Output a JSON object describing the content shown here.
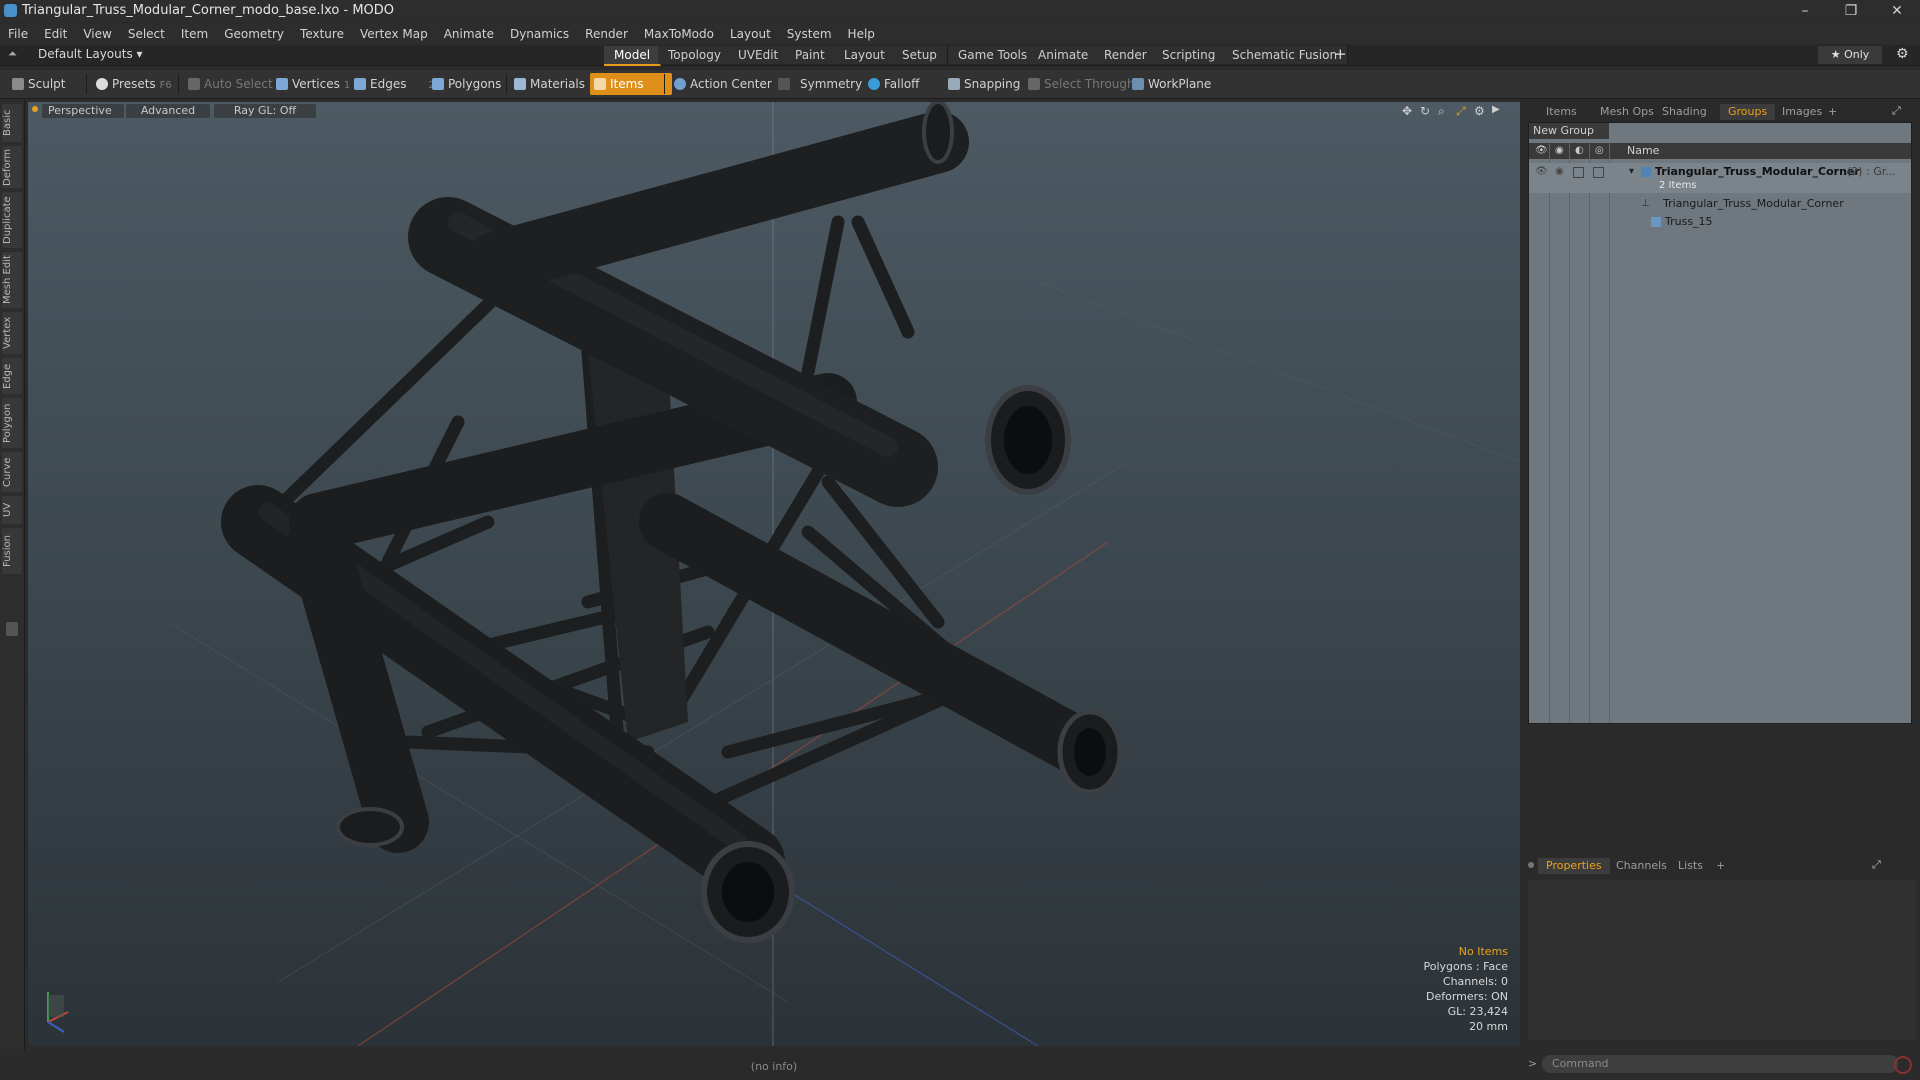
{
  "window": {
    "title": "Triangular_Truss_Modular_Corner_modo_base.lxo - MODO",
    "controls": [
      "–",
      "❐",
      "✕"
    ]
  },
  "menu": [
    "File",
    "Edit",
    "View",
    "Select",
    "Item",
    "Geometry",
    "Texture",
    "Vertex Map",
    "Animate",
    "Dynamics",
    "Render",
    "MaxToModo",
    "Layout",
    "System",
    "Help"
  ],
  "layoutbar": {
    "layouts_label": "Default Layouts ▾",
    "tabs": [
      "Model",
      "Topology",
      "UVEdit",
      "Paint",
      "Layout",
      "Setup",
      "Game Tools",
      "Animate",
      "Render",
      "Scripting",
      "Schematic Fusion"
    ],
    "active_tab": "Model",
    "add": "+",
    "only_label": "★  Only",
    "gear": "⚙"
  },
  "toolbar": {
    "sculpt": "Sculpt",
    "presets": "Presets",
    "presets_key": "F6",
    "auto_select": "Auto Select",
    "vertices": "Vertices",
    "vertices_key": "1",
    "edges": "Edges",
    "edges_key": "2",
    "polygons": "Polygons",
    "materials": "Materials",
    "items": "Items",
    "action_center": "Action Center",
    "symmetry": "Symmetry",
    "falloff": "Falloff",
    "snapping": "Snapping",
    "select_through": "Select Through",
    "workplane": "WorkPlane"
  },
  "left_tabs": [
    "Basic",
    "Deform",
    "Duplicate",
    "Mesh Edit",
    "Vertex",
    "Edge",
    "Polygon",
    "Curve",
    "UV",
    "Fusion"
  ],
  "viewport": {
    "view_mode": "Perspective",
    "shading": "Advanced",
    "raygl": "Ray GL: Off",
    "info": {
      "selection": "No Items",
      "polygons": "Polygons : Face",
      "channels": "Channels: 0",
      "deformers": "Deformers: ON",
      "gl": "GL: 23,424",
      "unit": "20 mm"
    },
    "status": "(no info)"
  },
  "right_panel": {
    "tabs": [
      "Items",
      "Mesh Ops",
      "Shading",
      "Groups",
      "Images",
      "+"
    ],
    "active_tab": "Groups",
    "new_group": "New Group",
    "name_col": "Name",
    "group_name": "Triangular_Truss_Modular_Corner",
    "group_suffix": "(2) : Gr...",
    "group_count": "2 Items",
    "children": [
      "Triangular_Truss_Modular_Corner",
      "Truss_15"
    ],
    "bottom_tabs": [
      "Properties",
      "Channels",
      "Lists",
      "+"
    ],
    "bottom_active": "Properties",
    "command_placeholder": "Command"
  },
  "colors": {
    "accent": "#e08f1a",
    "viewport_top": "#4d5a63",
    "viewport_bottom": "#2c3338",
    "truss": "#1f2123"
  }
}
